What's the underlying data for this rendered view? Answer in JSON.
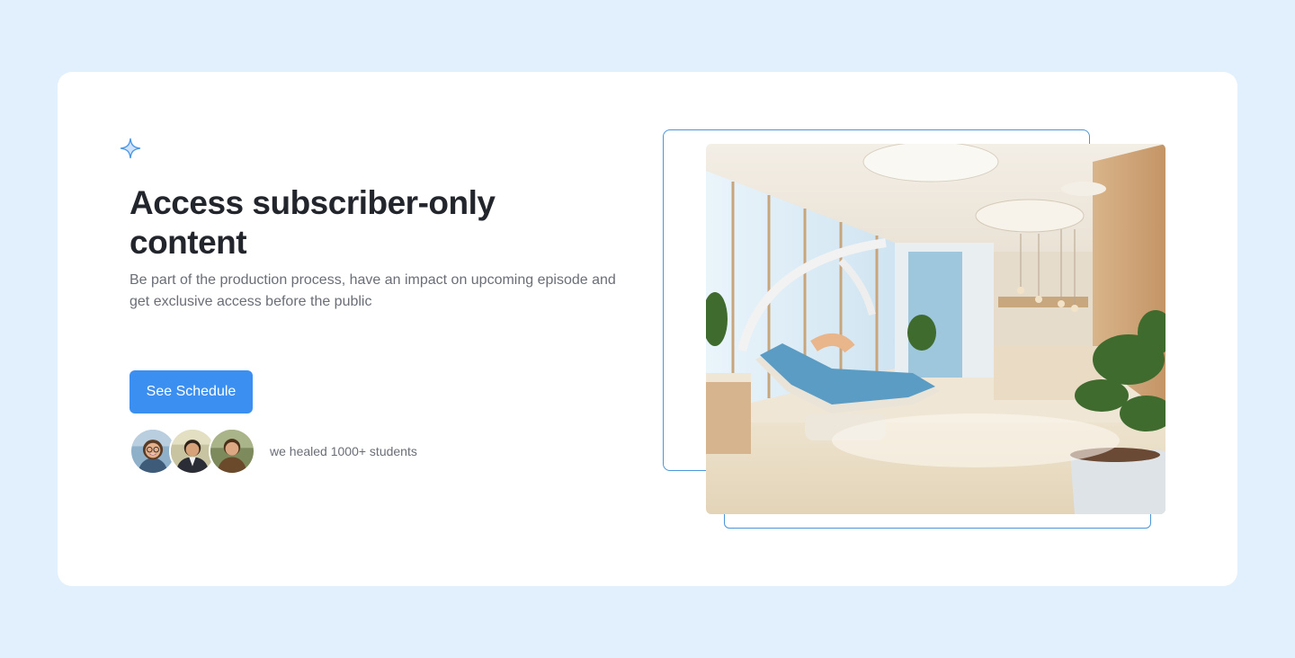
{
  "hero": {
    "icon": "sparkle-icon",
    "title": "Access subscriber-only content",
    "description": "Be part of the production process, have an impact on upcoming episode and get exclusive access before the public",
    "cta_label": "See Schedule",
    "social_proof": "we healed 1000+ students"
  },
  "avatars": [
    {
      "icon": "avatar-photo-woman-glasses"
    },
    {
      "icon": "avatar-photo-man-suit"
    },
    {
      "icon": "avatar-photo-man-jacket"
    }
  ],
  "image": {
    "icon": "dental-clinic-photo"
  },
  "colors": {
    "page_background": "#e2f0fd",
    "card_background": "#ffffff",
    "accent": "#3b8ff0",
    "frame_border": "#4b95d8",
    "heading": "#22252b",
    "body_text": "#6a6e76"
  }
}
